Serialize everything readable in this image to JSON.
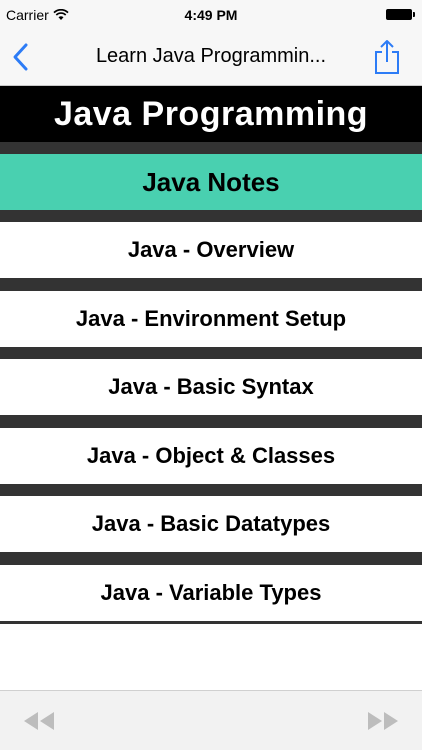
{
  "status_bar": {
    "carrier": "Carrier",
    "time": "4:49 PM"
  },
  "nav_bar": {
    "title": "Learn Java Programmin...",
    "back_icon": "chevron-left-icon",
    "share_icon": "share-icon",
    "accent_color": "#2d7cf6"
  },
  "header": {
    "title": "Java Programming"
  },
  "section": {
    "title": "Java Notes",
    "color": "#49d0b0"
  },
  "menu": {
    "items": [
      {
        "label": "Java - Overview"
      },
      {
        "label": "Java - Environment Setup"
      },
      {
        "label": "Java - Basic Syntax"
      },
      {
        "label": "Java - Object & Classes"
      },
      {
        "label": "Java - Basic Datatypes"
      },
      {
        "label": "Java - Variable Types"
      }
    ]
  },
  "toolbar": {
    "rewind_icon": "rewind-icon",
    "fast_forward_icon": "fast-forward-icon"
  }
}
